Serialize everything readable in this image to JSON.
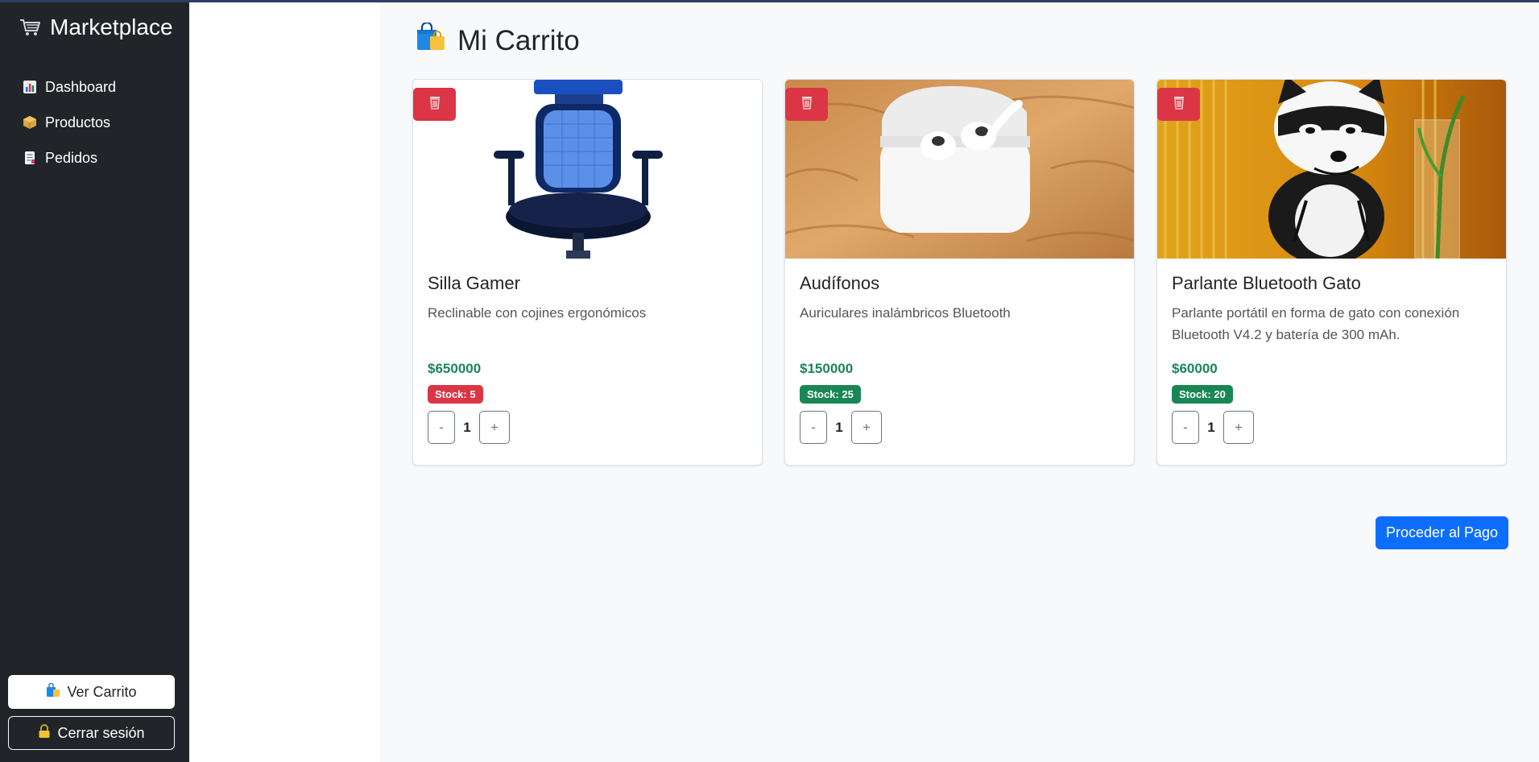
{
  "app": {
    "brand": "Marketplace",
    "brand_icon": "cart-icon"
  },
  "sidebar": {
    "items": [
      {
        "label": "Dashboard",
        "icon": "bar-chart-icon"
      },
      {
        "label": "Productos",
        "icon": "package-icon"
      },
      {
        "label": "Pedidos",
        "icon": "document-icon"
      }
    ],
    "cart_button": "Ver Carrito",
    "logout_button": "Cerrar sesión"
  },
  "page": {
    "title": "Mi Carrito",
    "title_icon": "shopping-bags-icon"
  },
  "cart": {
    "items": [
      {
        "name": "Silla Gamer",
        "description": "Reclinable con cojines ergonómicos",
        "price": "$650000",
        "stock": "Stock: 5",
        "stock_color": "#dc3545",
        "quantity": "1",
        "minus": "-",
        "plus": "+"
      },
      {
        "name": "Audífonos",
        "description": "Auriculares inalámbricos Bluetooth",
        "price": "$150000",
        "stock": "Stock: 25",
        "stock_color": "#198754",
        "quantity": "1",
        "minus": "-",
        "plus": "+"
      },
      {
        "name": "Parlante Bluetooth Gato",
        "description": "Parlante portátil en forma de gato con conexión Bluetooth V4.2 y batería de 300 mAh.",
        "price": "$60000",
        "stock": "Stock: 20",
        "stock_color": "#198754",
        "quantity": "1",
        "minus": "-",
        "plus": "+"
      }
    ],
    "checkout_button": "Proceder al Pago"
  },
  "colors": {
    "sidebar_bg": "#212529",
    "danger": "#dc3545",
    "success": "#198754",
    "primary": "#0d6efd"
  }
}
